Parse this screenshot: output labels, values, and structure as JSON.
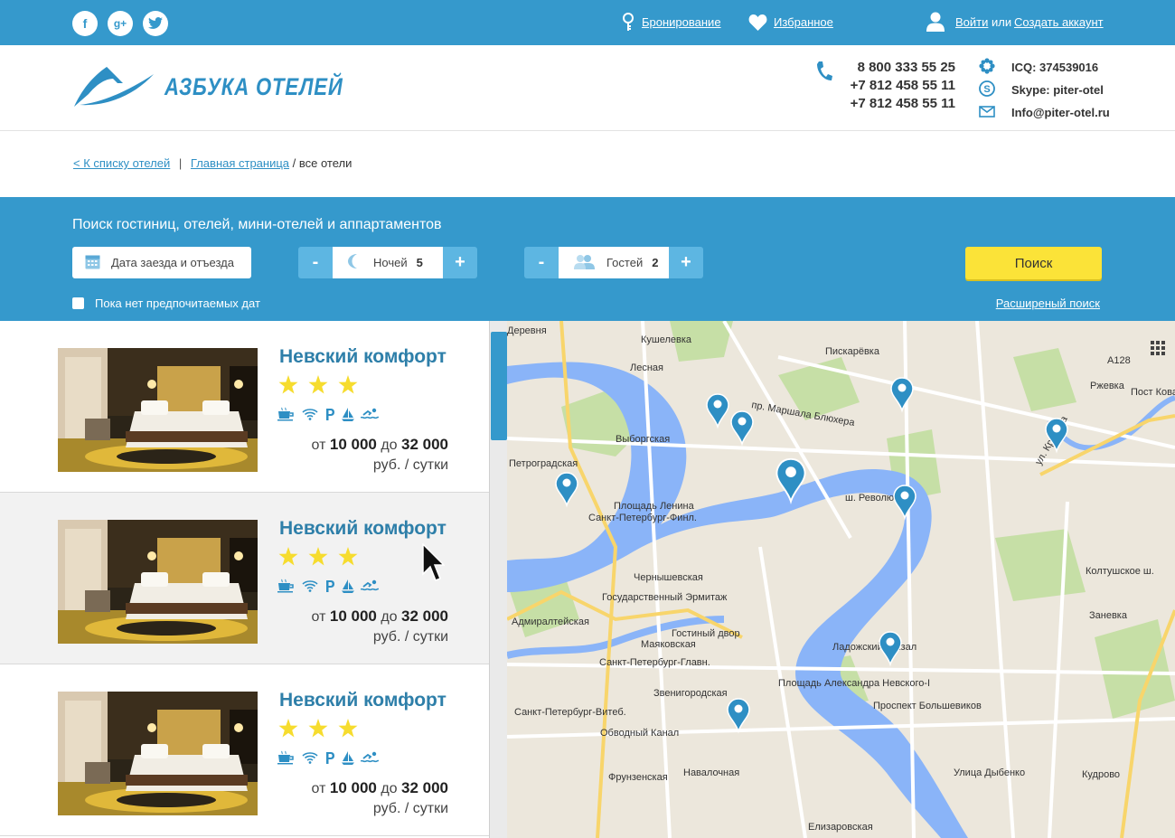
{
  "topbar": {
    "booking_label": "Бронирование",
    "favorites_label": "Избранное",
    "login_label": "Войти",
    "or_label": "или",
    "register_label": "Создать аккаунт"
  },
  "header": {
    "logo_text": "АЗБУКА ОТЕЛЕЙ",
    "phones": [
      "8 800 333 55 25",
      "+7 812 458 55 11",
      "+7 812 458 55 11"
    ],
    "icq": "ICQ: 374539016",
    "skype": "Skype: piter-otel",
    "email": "Info@piter-otel.ru"
  },
  "breadcrumbs": {
    "back": "< К списку отелей",
    "sep": "|",
    "home": "Главная страница",
    "current": "/ все отели"
  },
  "search": {
    "title": "Поиск гостиниц, отелей, мини-отелей и аппартаментов",
    "date_label": "Дата заезда и отъезда",
    "nights_label": "Ночей",
    "nights_value": "5",
    "guests_label": "Гостей",
    "guests_value": "2",
    "minus": "-",
    "plus": "+",
    "search_button": "Поиск",
    "no_dates_label": "Пока нет предпочитаемых дат",
    "advanced_link": "Расширеный поиск"
  },
  "hotels": [
    {
      "name": "Невский комфорт",
      "stars": 3,
      "from": "от",
      "price_min": "10 000",
      "to": "до",
      "price_max": "32 000",
      "unit": "руб. / сутки"
    },
    {
      "name": "Невский комфорт",
      "stars": 3,
      "from": "от",
      "price_min": "10 000",
      "to": "до",
      "price_max": "32 000",
      "unit": "руб. / сутки"
    },
    {
      "name": "Невский комфорт",
      "stars": 3,
      "from": "от",
      "price_min": "10 000",
      "to": "до",
      "price_max": "32 000",
      "unit": "руб. / сутки"
    }
  ],
  "map": {
    "labels": [
      "Деревня",
      "Кушелевка",
      "Пискарёвка",
      "Лесная",
      "Ржевка",
      "Пост Кова",
      "A128",
      "Выборгская",
      "Петроградская",
      "Площадь Ленина",
      "Санкт-Петербург-Финл.",
      "Чернышевская",
      "Государственный Эрмитаж",
      "Адмиралтейская",
      "Гостиный двор",
      "Маяковская",
      "Санкт-Петербург-Главн.",
      "Площадь Александра Невского-I",
      "Ладожский вокзал",
      "Проспект Большевиков",
      "Звенигородская",
      "Санкт-Петербург-Витеб.",
      "Обводный Канал",
      "Фрунзенская",
      "Навалочная",
      "Улица Дыбенко",
      "Кудрово",
      "Елизаровская",
      "Заневка",
      "Колтушское ш.",
      "пр. Маршала Блюхера",
      "ш. Революции",
      "ул. Красина"
    ]
  },
  "colors": {
    "accent": "#3599cc",
    "search_button": "#fbe338",
    "title": "#2e7fa9",
    "star": "#f6dc2e"
  }
}
